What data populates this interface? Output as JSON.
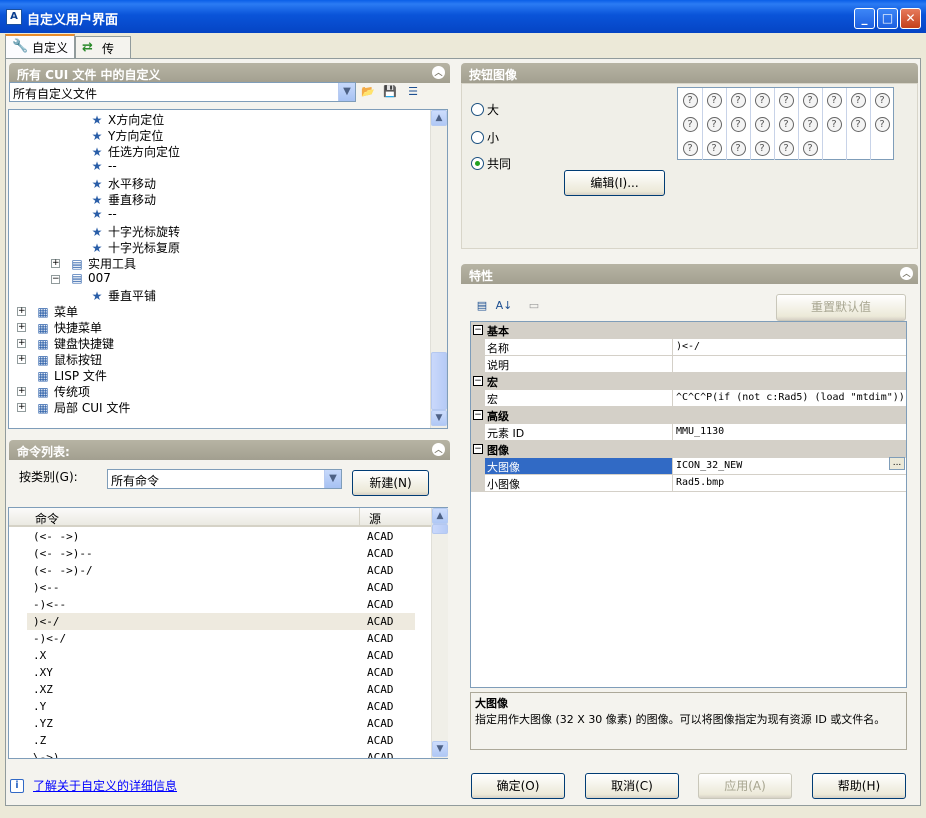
{
  "window": {
    "title": "自定义用户界面",
    "icon": "autocad-icon",
    "minimize": "_",
    "maximize": "□",
    "close": "✕"
  },
  "tabs": [
    {
      "label": "自定义",
      "icon": "wrench-icon"
    },
    {
      "label": "传输",
      "icon": "transfer-icon"
    }
  ],
  "left_panel": {
    "header": "所有 CUI 文件 中的自定义",
    "file_combo": "所有自定义文件",
    "tree": [
      {
        "label": "X方向定位",
        "indent": 3
      },
      {
        "label": "Y方向定位",
        "indent": 3
      },
      {
        "label": "任选方向定位",
        "indent": 3
      },
      {
        "label": "--",
        "indent": 3
      },
      {
        "label": "水平移动",
        "indent": 3
      },
      {
        "label": "垂直移动",
        "indent": 3
      },
      {
        "label": "--",
        "indent": 3
      },
      {
        "label": "十字光标旋转",
        "indent": 3
      },
      {
        "label": "十字光标复原",
        "indent": 3
      },
      {
        "label": "实用工具",
        "indent": 2
      },
      {
        "label": "007",
        "indent": 2
      },
      {
        "label": "垂直平铺",
        "indent": 3
      },
      {
        "label": "菜单",
        "indent": 1
      },
      {
        "label": "快捷菜单",
        "indent": 1
      },
      {
        "label": "键盘快捷键",
        "indent": 1
      },
      {
        "label": "鼠标按钮",
        "indent": 1
      },
      {
        "label": "LISP 文件",
        "indent": 1
      },
      {
        "label": "传统项",
        "indent": 1
      },
      {
        "label": "局部 CUI 文件",
        "indent": 1
      }
    ]
  },
  "command_list": {
    "header": "命令列表:",
    "category_label": "按类别(G):",
    "category_value": "所有命令",
    "new_button": "新建(N)",
    "columns": [
      "命令",
      "源"
    ],
    "rows": [
      {
        "cmd": "(<- ->)",
        "src": "ACAD"
      },
      {
        "cmd": "(<- ->)--",
        "src": "ACAD"
      },
      {
        "cmd": "(<- ->)-/",
        "src": "ACAD"
      },
      {
        "cmd": ")<--",
        "src": "ACAD"
      },
      {
        "cmd": "-)<--",
        "src": "ACAD"
      },
      {
        "cmd": ")<-/",
        "src": "ACAD"
      },
      {
        "cmd": "-)<-/",
        "src": "ACAD"
      },
      {
        "cmd": ".X",
        "src": "ACAD"
      },
      {
        "cmd": ".XY",
        "src": "ACAD"
      },
      {
        "cmd": ".XZ",
        "src": "ACAD"
      },
      {
        "cmd": ".Y",
        "src": "ACAD"
      },
      {
        "cmd": ".YZ",
        "src": "ACAD"
      },
      {
        "cmd": ".Z",
        "src": "ACAD"
      },
      {
        "cmd": "\\->)",
        "src": "ACAD"
      }
    ],
    "selected_row": 5
  },
  "button_image": {
    "header": "按钮图像",
    "options": [
      "大",
      "小",
      "共同"
    ],
    "selected": "共同",
    "edit_button": "编辑(I)...",
    "image_count": 24
  },
  "properties": {
    "header": "特性",
    "reset_button": "重置默认值",
    "rows": [
      {
        "type": "cat",
        "name": "基本"
      },
      {
        "type": "prop",
        "name": "名称",
        "value": ")<-/"
      },
      {
        "type": "prop",
        "name": "说明",
        "value": ""
      },
      {
        "type": "cat",
        "name": "宏"
      },
      {
        "type": "prop",
        "name": "宏",
        "value": "^C^C^P(if (not c:Rad5) (load \"mtdim\"))"
      },
      {
        "type": "cat",
        "name": "高级"
      },
      {
        "type": "prop",
        "name": "元素 ID",
        "value": "MMU_1130"
      },
      {
        "type": "cat",
        "name": "图像"
      },
      {
        "type": "prop",
        "name": "大图像",
        "value": "ICON_32_NEW",
        "selected": true
      },
      {
        "type": "prop",
        "name": "小图像",
        "value": "Rad5.bmp"
      }
    ],
    "description_title": "大图像",
    "description_text": "指定用作大图像 (32 X 30 像素) 的图像。可以将图像指定为现有资源 ID 或文件名。"
  },
  "footer": {
    "help_link": "了解关于自定义的详细信息",
    "ok": "确定(O)",
    "cancel": "取消(C)",
    "apply": "应用(A)",
    "help": "帮助(H)"
  },
  "colors": {
    "title_bar": "#0a54d9",
    "selection": "#316ac5",
    "panel_header": "#a8a594",
    "link": "#0000ff"
  }
}
